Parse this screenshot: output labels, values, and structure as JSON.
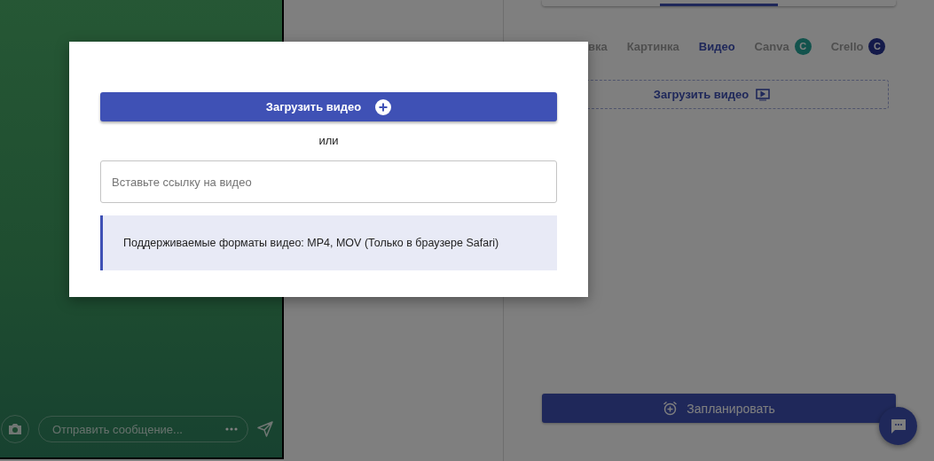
{
  "preview": {
    "message_placeholder": "Отправить сообщение..."
  },
  "top_tabs": [
    {
      "selected": false
    },
    {
      "selected": true
    },
    {
      "selected": false
    }
  ],
  "media_tabs": [
    {
      "label": "вка",
      "selected": false
    },
    {
      "label": "Картинка",
      "selected": false
    },
    {
      "label": "Видео",
      "selected": true
    },
    {
      "label": "Canva",
      "selected": false,
      "badge": "C",
      "color": "#13534d"
    },
    {
      "label": "Crello",
      "selected": false,
      "badge": "C",
      "color": "#141a4a"
    }
  ],
  "upload_area": {
    "label": "Загрузить видео"
  },
  "schedule_button": "Запланировать",
  "modal": {
    "upload_button": "Загрузить видео",
    "separator": "или",
    "link_field": {
      "placeholder": "Вставьте ссылку на видео"
    },
    "note": "Поддерживаемые форматы видео: MP4, MOV (Только в браузере Safari)"
  }
}
